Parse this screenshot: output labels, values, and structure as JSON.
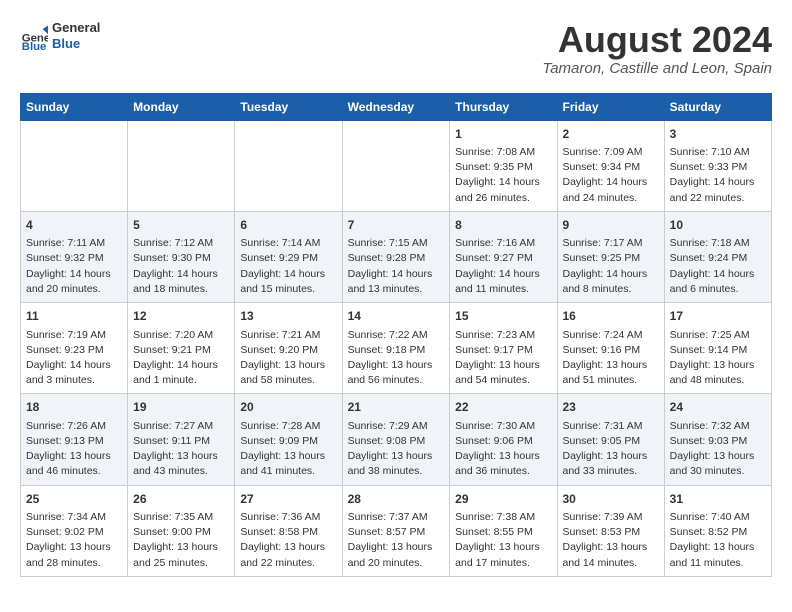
{
  "header": {
    "logo_general": "General",
    "logo_blue": "Blue",
    "month_year": "August 2024",
    "location": "Tamaron, Castille and Leon, Spain"
  },
  "weekdays": [
    "Sunday",
    "Monday",
    "Tuesday",
    "Wednesday",
    "Thursday",
    "Friday",
    "Saturday"
  ],
  "rows": [
    [
      {
        "day": "",
        "lines": []
      },
      {
        "day": "",
        "lines": []
      },
      {
        "day": "",
        "lines": []
      },
      {
        "day": "",
        "lines": []
      },
      {
        "day": "1",
        "lines": [
          "Sunrise: 7:08 AM",
          "Sunset: 9:35 PM",
          "Daylight: 14 hours",
          "and 26 minutes."
        ]
      },
      {
        "day": "2",
        "lines": [
          "Sunrise: 7:09 AM",
          "Sunset: 9:34 PM",
          "Daylight: 14 hours",
          "and 24 minutes."
        ]
      },
      {
        "day": "3",
        "lines": [
          "Sunrise: 7:10 AM",
          "Sunset: 9:33 PM",
          "Daylight: 14 hours",
          "and 22 minutes."
        ]
      }
    ],
    [
      {
        "day": "4",
        "lines": [
          "Sunrise: 7:11 AM",
          "Sunset: 9:32 PM",
          "Daylight: 14 hours",
          "and 20 minutes."
        ]
      },
      {
        "day": "5",
        "lines": [
          "Sunrise: 7:12 AM",
          "Sunset: 9:30 PM",
          "Daylight: 14 hours",
          "and 18 minutes."
        ]
      },
      {
        "day": "6",
        "lines": [
          "Sunrise: 7:14 AM",
          "Sunset: 9:29 PM",
          "Daylight: 14 hours",
          "and 15 minutes."
        ]
      },
      {
        "day": "7",
        "lines": [
          "Sunrise: 7:15 AM",
          "Sunset: 9:28 PM",
          "Daylight: 14 hours",
          "and 13 minutes."
        ]
      },
      {
        "day": "8",
        "lines": [
          "Sunrise: 7:16 AM",
          "Sunset: 9:27 PM",
          "Daylight: 14 hours",
          "and 11 minutes."
        ]
      },
      {
        "day": "9",
        "lines": [
          "Sunrise: 7:17 AM",
          "Sunset: 9:25 PM",
          "Daylight: 14 hours",
          "and 8 minutes."
        ]
      },
      {
        "day": "10",
        "lines": [
          "Sunrise: 7:18 AM",
          "Sunset: 9:24 PM",
          "Daylight: 14 hours",
          "and 6 minutes."
        ]
      }
    ],
    [
      {
        "day": "11",
        "lines": [
          "Sunrise: 7:19 AM",
          "Sunset: 9:23 PM",
          "Daylight: 14 hours",
          "and 3 minutes."
        ]
      },
      {
        "day": "12",
        "lines": [
          "Sunrise: 7:20 AM",
          "Sunset: 9:21 PM",
          "Daylight: 14 hours",
          "and 1 minute."
        ]
      },
      {
        "day": "13",
        "lines": [
          "Sunrise: 7:21 AM",
          "Sunset: 9:20 PM",
          "Daylight: 13 hours",
          "and 58 minutes."
        ]
      },
      {
        "day": "14",
        "lines": [
          "Sunrise: 7:22 AM",
          "Sunset: 9:18 PM",
          "Daylight: 13 hours",
          "and 56 minutes."
        ]
      },
      {
        "day": "15",
        "lines": [
          "Sunrise: 7:23 AM",
          "Sunset: 9:17 PM",
          "Daylight: 13 hours",
          "and 54 minutes."
        ]
      },
      {
        "day": "16",
        "lines": [
          "Sunrise: 7:24 AM",
          "Sunset: 9:16 PM",
          "Daylight: 13 hours",
          "and 51 minutes."
        ]
      },
      {
        "day": "17",
        "lines": [
          "Sunrise: 7:25 AM",
          "Sunset: 9:14 PM",
          "Daylight: 13 hours",
          "and 48 minutes."
        ]
      }
    ],
    [
      {
        "day": "18",
        "lines": [
          "Sunrise: 7:26 AM",
          "Sunset: 9:13 PM",
          "Daylight: 13 hours",
          "and 46 minutes."
        ]
      },
      {
        "day": "19",
        "lines": [
          "Sunrise: 7:27 AM",
          "Sunset: 9:11 PM",
          "Daylight: 13 hours",
          "and 43 minutes."
        ]
      },
      {
        "day": "20",
        "lines": [
          "Sunrise: 7:28 AM",
          "Sunset: 9:09 PM",
          "Daylight: 13 hours",
          "and 41 minutes."
        ]
      },
      {
        "day": "21",
        "lines": [
          "Sunrise: 7:29 AM",
          "Sunset: 9:08 PM",
          "Daylight: 13 hours",
          "and 38 minutes."
        ]
      },
      {
        "day": "22",
        "lines": [
          "Sunrise: 7:30 AM",
          "Sunset: 9:06 PM",
          "Daylight: 13 hours",
          "and 36 minutes."
        ]
      },
      {
        "day": "23",
        "lines": [
          "Sunrise: 7:31 AM",
          "Sunset: 9:05 PM",
          "Daylight: 13 hours",
          "and 33 minutes."
        ]
      },
      {
        "day": "24",
        "lines": [
          "Sunrise: 7:32 AM",
          "Sunset: 9:03 PM",
          "Daylight: 13 hours",
          "and 30 minutes."
        ]
      }
    ],
    [
      {
        "day": "25",
        "lines": [
          "Sunrise: 7:34 AM",
          "Sunset: 9:02 PM",
          "Daylight: 13 hours",
          "and 28 minutes."
        ]
      },
      {
        "day": "26",
        "lines": [
          "Sunrise: 7:35 AM",
          "Sunset: 9:00 PM",
          "Daylight: 13 hours",
          "and 25 minutes."
        ]
      },
      {
        "day": "27",
        "lines": [
          "Sunrise: 7:36 AM",
          "Sunset: 8:58 PM",
          "Daylight: 13 hours",
          "and 22 minutes."
        ]
      },
      {
        "day": "28",
        "lines": [
          "Sunrise: 7:37 AM",
          "Sunset: 8:57 PM",
          "Daylight: 13 hours",
          "and 20 minutes."
        ]
      },
      {
        "day": "29",
        "lines": [
          "Sunrise: 7:38 AM",
          "Sunset: 8:55 PM",
          "Daylight: 13 hours",
          "and 17 minutes."
        ]
      },
      {
        "day": "30",
        "lines": [
          "Sunrise: 7:39 AM",
          "Sunset: 8:53 PM",
          "Daylight: 13 hours",
          "and 14 minutes."
        ]
      },
      {
        "day": "31",
        "lines": [
          "Sunrise: 7:40 AM",
          "Sunset: 8:52 PM",
          "Daylight: 13 hours",
          "and 11 minutes."
        ]
      }
    ]
  ]
}
